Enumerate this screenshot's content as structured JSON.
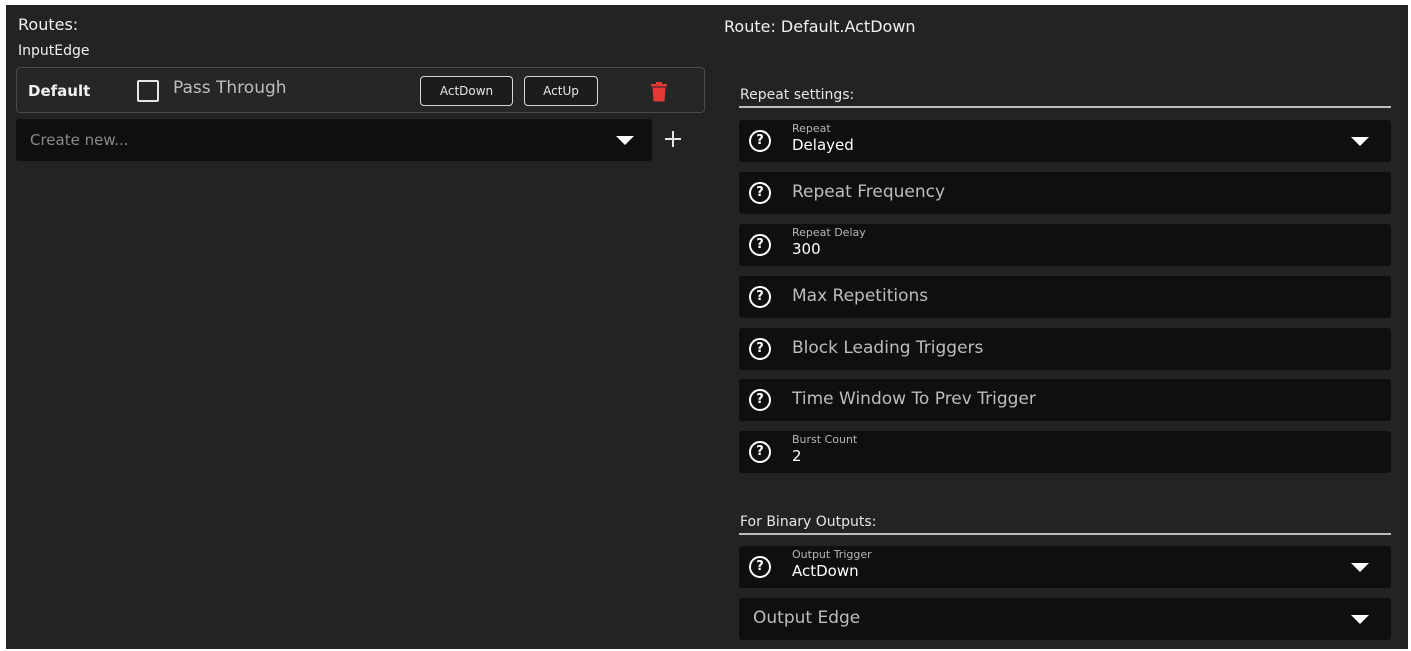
{
  "left": {
    "title": "Routes:",
    "group": "InputEdge",
    "route": {
      "name": "Default",
      "pass_through_label": "Pass Through",
      "pass_through_checked": false,
      "buttons": [
        "ActDown",
        "ActUp"
      ],
      "delete_icon": "trash-icon",
      "delete_color": "#e53935"
    },
    "create": {
      "placeholder": "Create new...",
      "add_icon": "plus-icon"
    }
  },
  "right": {
    "title": "Route: Default.ActDown",
    "repeat_section": {
      "title": "Repeat settings:",
      "fields": [
        {
          "label": "Repeat",
          "value": "Delayed",
          "type": "select"
        },
        {
          "label": "Repeat Frequency",
          "value": "",
          "type": "input"
        },
        {
          "label": "Repeat Delay",
          "value": "300",
          "type": "input"
        },
        {
          "label": "Max Repetitions",
          "value": "",
          "type": "input"
        },
        {
          "label": "Block Leading Triggers",
          "value": "",
          "type": "input"
        },
        {
          "label": "Time Window To Prev Trigger",
          "value": "",
          "type": "input"
        },
        {
          "label": "Burst Count",
          "value": "2",
          "type": "input"
        }
      ]
    },
    "binary_section": {
      "title": "For Binary Outputs:",
      "fields": [
        {
          "label": "Output Trigger",
          "value": "ActDown",
          "type": "select"
        },
        {
          "label": "Output Edge",
          "value": "",
          "type": "select"
        }
      ]
    }
  },
  "colors": {
    "background": "#232323",
    "field_background": "#0f0f0f",
    "text": "#e6e6e6",
    "muted_text": "#bdbdbd"
  }
}
